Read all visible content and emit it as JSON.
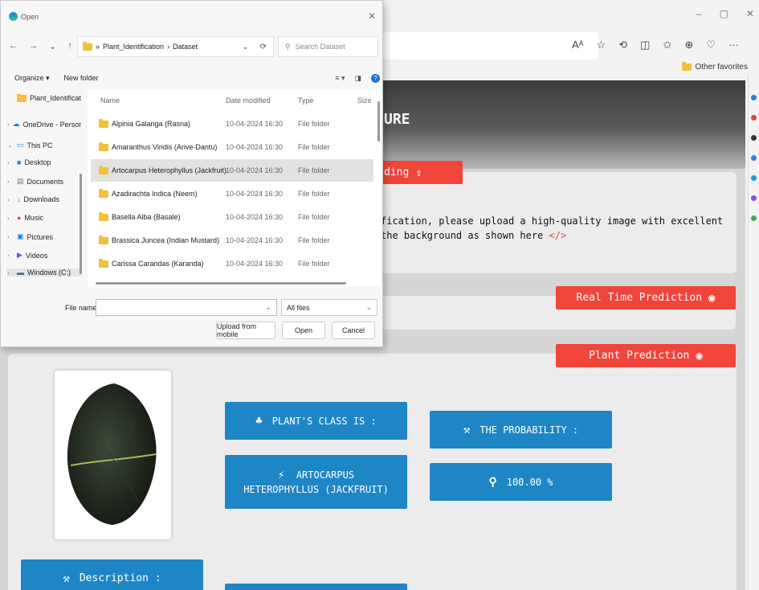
{
  "browser": {
    "win_controls": [
      "–",
      "▢",
      "✕"
    ],
    "toolbar_icons": [
      "Aᴬ",
      "☆",
      "⟲",
      "◫",
      "✩",
      "⊕",
      "♡",
      "···"
    ],
    "favorites_label": "Other favorites"
  },
  "page": {
    "hero_title": "URE",
    "upload_tab_label": "ding",
    "info_line1": "fication, please upload a high-quality image with excellent",
    "info_line2": "the background as shown here",
    "info_code_icon": "</>",
    "real_time_label": "Real Time Prediction",
    "plant_prediction_label": "Plant Prediction",
    "class_label": "PLANT'S CLASS IS :",
    "probability_label": "THE PROBABILITY :",
    "class_value_line1": "ARTOCARPUS",
    "class_value_line2": "HETEROPHYLLUS (JACKFRUIT)",
    "probability_value": "100.00 %",
    "description_label": "Description :"
  },
  "dialog": {
    "title": "Open",
    "breadcrumb_root": "»",
    "breadcrumb_1": "Plant_Identification",
    "breadcrumb_sep": "›",
    "breadcrumb_2": "Dataset",
    "search_placeholder": "Search Dataset",
    "organize_label": "Organize ▾",
    "new_folder_label": "New folder",
    "nav_tree": [
      {
        "label": "Plant_Identificat",
        "chev": ""
      },
      {
        "label": "OneDrive - Person",
        "chev": "›"
      },
      {
        "label": "This PC",
        "chev": "⌄"
      },
      {
        "label": "Desktop",
        "chev": "›"
      },
      {
        "label": "Documents",
        "chev": "›"
      },
      {
        "label": "Downloads",
        "chev": "›"
      },
      {
        "label": "Music",
        "chev": "›"
      },
      {
        "label": "Pictures",
        "chev": "›"
      },
      {
        "label": "Videos",
        "chev": "›"
      },
      {
        "label": "Windows (C:)",
        "chev": "›"
      }
    ],
    "columns": {
      "name": "Name",
      "date": "Date modified",
      "type": "Type",
      "size": "Size"
    },
    "files": [
      {
        "name": "Alpinia Galanga (Rasna)",
        "date": "10-04-2024 16:30",
        "type": "File folder"
      },
      {
        "name": "Amaranthus Viridis (Arive-Dantu)",
        "date": "10-04-2024 16:30",
        "type": "File folder"
      },
      {
        "name": "Artocarpus Heterophyllus (Jackfruit)",
        "date": "10-04-2024 16:30",
        "type": "File folder"
      },
      {
        "name": "Azadirachta Indica (Neem)",
        "date": "10-04-2024 16:30",
        "type": "File folder"
      },
      {
        "name": "Basella Alba (Basale)",
        "date": "10-04-2024 16:30",
        "type": "File folder"
      },
      {
        "name": "Brassica Juncea (Indian Mustard)",
        "date": "10-04-2024 16:30",
        "type": "File folder"
      },
      {
        "name": "Carissa Carandas (Karanda)",
        "date": "10-04-2024 16:30",
        "type": "File folder"
      }
    ],
    "selected_file_index": 2,
    "file_name_label": "File name:",
    "file_name_value": "",
    "filter_value": "All files",
    "upload_mobile_label": "Upload from mobile",
    "open_label": "Open",
    "cancel_label": "Cancel"
  },
  "colors": {
    "red_tab": "#f0453a",
    "blue_box": "#1e86c5",
    "selection": "#e2e2e2"
  }
}
